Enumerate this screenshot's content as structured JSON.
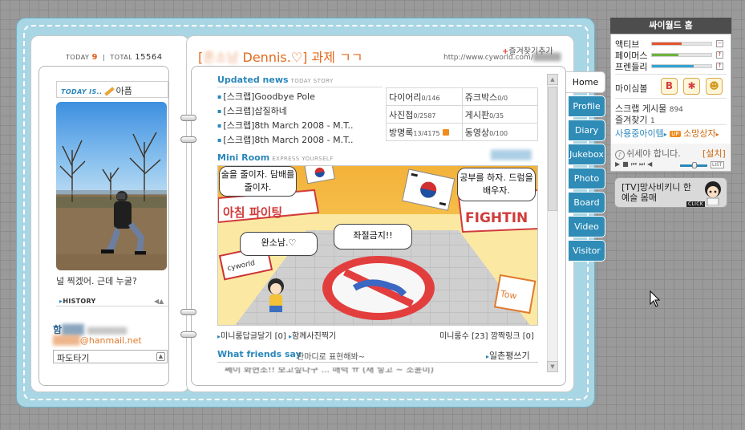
{
  "header": {
    "today_label": "TODAY",
    "today_value": "9",
    "total_label": "TOTAL",
    "total_value": "15564",
    "owner_blurred": "혼소남",
    "title": "Dennis.♡] 과제 ㄱㄱ",
    "title_prefix": "[",
    "favorite_label": "즐겨찾기추가",
    "url": "http://www.cyworld.com/"
  },
  "profile": {
    "today_is_label": "TODAY IS..",
    "mood": "아픔",
    "caption": "널 찍겠어. 근데 누굴?",
    "history_label": "HISTORY",
    "name_visible": "함",
    "email_suffix": "@hanmail.net",
    "wave_select": "파도타기"
  },
  "updated_news": {
    "title": "Updated news",
    "subtitle": "TODAY STORY",
    "items": [
      "[스크랩]Goodbye Pole",
      "[스크랩]삽질하네",
      "[스크랩]8th March 2008 - M.T..",
      "[스크랩]8th March 2008 - M.T.."
    ]
  },
  "counts": [
    {
      "label": "다이어리",
      "value": "0/146"
    },
    {
      "label": "쥬크박스",
      "value": "0/0"
    },
    {
      "label": "사진첩",
      "value": "0/2587"
    },
    {
      "label": "게시판",
      "value": "0/35"
    },
    {
      "label": "방명록",
      "value": "13/4175"
    },
    {
      "label": "동영상",
      "value": "0/100"
    }
  ],
  "miniroom": {
    "title": "Mini Room",
    "subtitle": "EXPRESS YOURSELF",
    "bubbles": {
      "left_top": "술을 줄이자. 담배를 줄이자.",
      "right_top": "공부를 하자. 드럼을 배우자.",
      "left_mid": "완소남.♡",
      "center": "좌절금지!!"
    },
    "banner_left": "아침 파이팅",
    "banner_right": "FIGHTIN",
    "sign": "cyworld",
    "links": {
      "reply": "미니룸답글달기",
      "reply_count": "[0]",
      "group_photo": "함께사진찍기",
      "visitors": "미니룸수",
      "visitors_count": "[23]",
      "blink": "깜짝링크",
      "blink_count": "[0]"
    }
  },
  "friends": {
    "title": "What friends say",
    "subtitle": "한마디로 표현해봐~",
    "button": "일촌평쓰기",
    "preview": "쎄이 화현초!! 보고싶다구 ... 매력 ㅠ (재 넣고 ~ 조윤미)"
  },
  "tabs": [
    "Home",
    "Profile",
    "Diary",
    "Jukebox",
    "Photo",
    "Board",
    "Video",
    "Visitor"
  ],
  "cyworld": {
    "header": "싸이월드 홈",
    "stats": [
      {
        "label": "액티브",
        "level": 0.5,
        "color": "#e4552d",
        "btn": "−"
      },
      {
        "label": "페이머스",
        "level": 0.45,
        "color": "#6db33f",
        "btn": "↑"
      },
      {
        "label": "프렌들리",
        "level": 0.7,
        "color": "#33a4d4",
        "btn": "↑"
      }
    ],
    "mysim_label": "마이심볼",
    "scrap_label": "스크랩 게시물",
    "scrap_value": "894",
    "fav_label": "즐겨찾기",
    "fav_value": "1",
    "items_label": "사용중아이템",
    "up_label": "UP",
    "shop_label": "소망상자",
    "music_title": "쉬세야 합니다.",
    "music_install": "[설치]",
    "list_label": "LIST",
    "tv_text": "[TV]망사비키니 한 예슬 몸매",
    "click_label": "CLICK"
  }
}
